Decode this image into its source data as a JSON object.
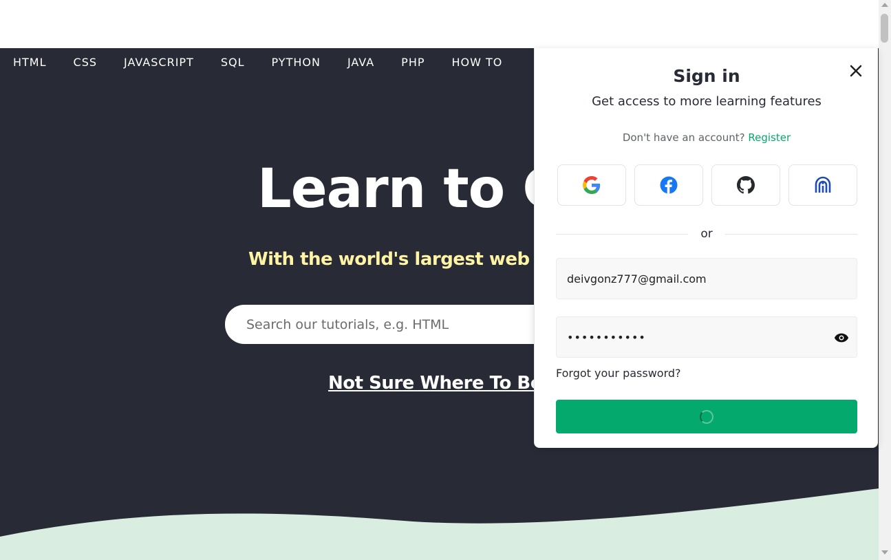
{
  "nav": {
    "items": [
      "HTML",
      "CSS",
      "JAVASCRIPT",
      "SQL",
      "PYTHON",
      "JAVA",
      "PHP",
      "HOW TO"
    ]
  },
  "hero": {
    "title": "Learn to Co",
    "subtitle": "With the world's largest web deve",
    "search_placeholder": "Search our tutorials, e.g. HTML",
    "begin_link": "Not Sure Where To Begi"
  },
  "modal": {
    "title": "Sign in",
    "subtitle": "Get access to more learning features",
    "register_prompt": "Don't have an account?",
    "register_link": "Register",
    "social_buttons": [
      "google-icon",
      "facebook-icon",
      "github-icon",
      "institution-icon"
    ],
    "or_text": "or",
    "email_value": "deivgonz777@gmail.com",
    "password_value": "•••••••••••",
    "forgot_password": "Forgot your password?",
    "submit_state": "loading"
  },
  "colors": {
    "brand_green": "#04aa6d",
    "nav_bg": "#282a35",
    "subtitle_yellow": "#fff4a3",
    "wave_green": "#d9eee1"
  }
}
